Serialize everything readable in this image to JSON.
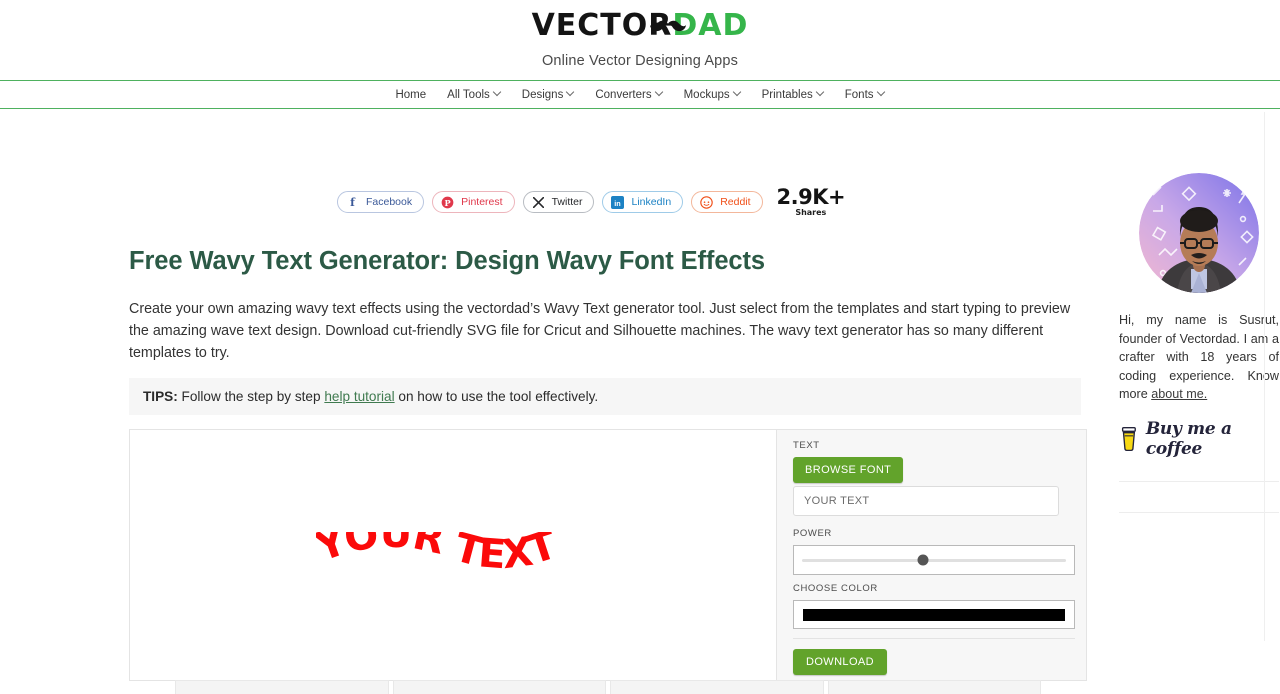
{
  "header": {
    "logo_part1": "VECTOR",
    "logo_part2": "DAD",
    "tagline": "Online Vector Designing Apps",
    "nav": [
      {
        "label": "Home",
        "caret": false
      },
      {
        "label": "All Tools",
        "caret": true
      },
      {
        "label": "Designs",
        "caret": true
      },
      {
        "label": "Converters",
        "caret": true
      },
      {
        "label": "Mockups",
        "caret": true
      },
      {
        "label": "Printables",
        "caret": true
      },
      {
        "label": "Fonts",
        "caret": true
      }
    ]
  },
  "share": {
    "buttons": [
      {
        "label": "Facebook",
        "icon": "facebook-icon",
        "glyph": "f",
        "color": "#3b5998"
      },
      {
        "label": "Pinterest",
        "icon": "pinterest-icon",
        "glyph": "P",
        "color": "#e0384b"
      },
      {
        "label": "Twitter",
        "icon": "twitter-x-icon",
        "glyph": "X",
        "color": "#26282b"
      },
      {
        "label": "LinkedIn",
        "icon": "linkedin-icon",
        "glyph": "in",
        "color": "#1c82c4"
      },
      {
        "label": "Reddit",
        "icon": "reddit-icon",
        "glyph": "@",
        "color": "#f04f18"
      }
    ],
    "count": "2.9K+",
    "count_label": "Shares"
  },
  "article": {
    "title": "Free Wavy Text Generator: Design Wavy Font Effects",
    "intro": "Create your own amazing wavy text effects using the vectordad’s Wavy Text generator tool. Just select from the templates and start typing to preview the amazing wave text design. Download cut-friendly SVG file for Cricut and Silhouette machines. The wavy text generator has so many different templates to try.",
    "tips_label": "TIPS:",
    "tips_before": " Follow the step by step ",
    "tips_link": "help tutorial",
    "tips_after": " on how to use the tool effectively."
  },
  "tool": {
    "preview_text": "YOUR TEXT",
    "preview_color": "#fb0a0a",
    "text_label": "TEXT",
    "browse_font_label": "BROWSE FONT",
    "text_input_value": "YOUR TEXT",
    "text_input_placeholder": "YOUR TEXT",
    "power_label": "POWER",
    "power_value": 46,
    "choose_color_label": "CHOOSE COLOR",
    "selected_color": "#000000",
    "download_label": "DOWNLOAD",
    "accent_green": "#62a32b"
  },
  "sidebar": {
    "avatar_alt": "author-avatar",
    "bio_text": "Hi, my name is Susrut, founder of Vectordad. I am a crafter with 18 years of coding experience. Know more ",
    "bio_link": "about me.",
    "coffee_label": "Buy me a coffee"
  }
}
